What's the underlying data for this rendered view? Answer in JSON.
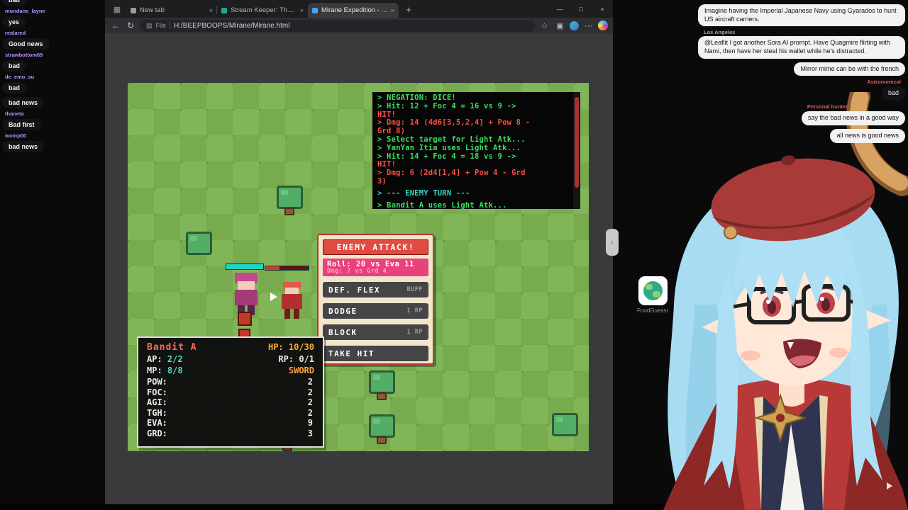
{
  "palette": {
    "grass_light": "#80b657",
    "grass_dark": "#77ab4e",
    "terminal_green": "#3ae160",
    "terminal_red": "#ff4f42",
    "terminal_cyan": "#2fd9c9",
    "dialog_red": "#e14b42",
    "dialog_pink": "#e8427d",
    "hp_orange": "#ffaa33",
    "name_red": "#ff6860",
    "mp_teal": "#57d8c6",
    "weapon_orange": "#ff9f43"
  },
  "browser": {
    "tab_strip": {
      "tab_actions_icon": "▦",
      "tabs": [
        {
          "label": "New tab",
          "state": "inactive",
          "favicon": "#9e9e9e",
          "close": "×"
        },
        {
          "label": "Stream Keeper: The Dog Control",
          "state": "inactive",
          "favicon": "#26a69a",
          "close": "×"
        },
        {
          "label": "Mirane Expedition - Angel's Swo",
          "state": "active",
          "favicon": "#42a5f5",
          "close": "×"
        }
      ],
      "new_tab_button": "+",
      "window_controls": {
        "minimize": "—",
        "maximize": "□",
        "close": "×"
      }
    },
    "toolbar": {
      "back_icon": "←",
      "refresh_icon": "↻",
      "doc_icon": "▤",
      "scheme_label": "File",
      "url": "H:/BEEPBOOPS/Mirane/Mirane.html",
      "star_icon": "☆",
      "split_icon": "▣",
      "more_icon": "⋯"
    },
    "side_handle_icon": "‹"
  },
  "game": {
    "log_lines": [
      {
        "text": "> NEGATION: DICE!",
        "color": "green"
      },
      {
        "text": "> Hit: 12 + Foc 4 = 16 vs 9 ->",
        "color": "green"
      },
      {
        "text": "HIT!",
        "color": "red"
      },
      {
        "text": "> Dmg: 14 (4d6[3,5,2,4] + Pow 8 -",
        "color": "red"
      },
      {
        "text": "Grd 8)",
        "color": "red"
      },
      {
        "text": "> Select target for Light Atk...",
        "color": "green"
      },
      {
        "text": "> YanYan Itia uses Light Atk...",
        "color": "green"
      },
      {
        "text": "> Hit: 14 + Foc 4 = 18 vs 9 ->",
        "color": "green"
      },
      {
        "text": "HIT!",
        "color": "red"
      },
      {
        "text": "> Dmg: 6 (2d4[1,4] + Pow 4 - Grd",
        "color": "red"
      },
      {
        "text": "3)",
        "color": "red"
      },
      {
        "text": "> --- ENEMY TURN ---",
        "color": "cyan gap"
      },
      {
        "text": "> Bandit A uses Light Atk...",
        "color": "green gap"
      }
    ],
    "attack_dialog": {
      "title": "ENEMY ATTACK!",
      "roll_line": "Roll: 20 vs Eva 11",
      "dmg_line": "Dmg: 7 vs Grd 4",
      "options": [
        {
          "label": "DEF. FLEX",
          "tag": "BUFF"
        },
        {
          "label": "DODGE",
          "tag": "1 RP"
        },
        {
          "label": "BLOCK",
          "tag": "1 RP"
        },
        {
          "label": "TAKE HIT",
          "tag": ""
        }
      ]
    },
    "stats_panel": {
      "name": "Bandit A",
      "hp": "HP: 10/30",
      "ap_label": "AP:",
      "ap_value": "2/2",
      "rp_label": "RP:",
      "rp_value": "0/1",
      "mp_label": "MP:",
      "mp_value": "8/8",
      "weapon": "SWORD",
      "stats": [
        {
          "label": "POW:",
          "value": "2"
        },
        {
          "label": "FOC:",
          "value": "2"
        },
        {
          "label": "AGI:",
          "value": "2"
        },
        {
          "label": "TGH:",
          "value": "2"
        },
        {
          "label": "EVA:",
          "value": "9"
        },
        {
          "label": "GRD:",
          "value": "3"
        }
      ]
    }
  },
  "left_chat": {
    "messages": [
      {
        "user": "",
        "text": "bad"
      },
      {
        "user": "mundane_layne",
        "text": "yes"
      },
      {
        "user": "realared",
        "text": "Good news"
      },
      {
        "user": "strawbottom69",
        "text": "bad"
      },
      {
        "user": "de_emo_su",
        "text": "bad"
      },
      {
        "user": "",
        "text": "bad news"
      },
      {
        "user": "thaneta",
        "text": "Bad first"
      },
      {
        "user": "womp00",
        "text": "bad news"
      }
    ]
  },
  "right_chat": {
    "messages": [
      {
        "user": "",
        "user_color": "",
        "style": "light",
        "text": "Imagine having the Imperial Japanese Navy using Gyarados to hunt US aircraft carriers."
      },
      {
        "user": "Los Angeles",
        "user_color": "#a8a8a8",
        "style": "light",
        "text": "@Leaflit I got another Sora AI prompt. Have Quagmire flirting with Nami, then have her steal his wallet while he's distracted."
      },
      {
        "user": "",
        "user_color": "",
        "style": "light",
        "text": "Mirror mime can be with the french"
      },
      {
        "user": "Astronomical",
        "user_color": "#e05a5a",
        "style": "dark",
        "text": "bad"
      },
      {
        "user": "Personal hunter",
        "user_color": "#e05a5a",
        "style": "light",
        "text": "say the bad news in a good way"
      },
      {
        "user": "",
        "user_color": "",
        "style": "light",
        "text": "all news is good news"
      }
    ]
  },
  "foodguessr": {
    "label": "FoodGuessr"
  }
}
